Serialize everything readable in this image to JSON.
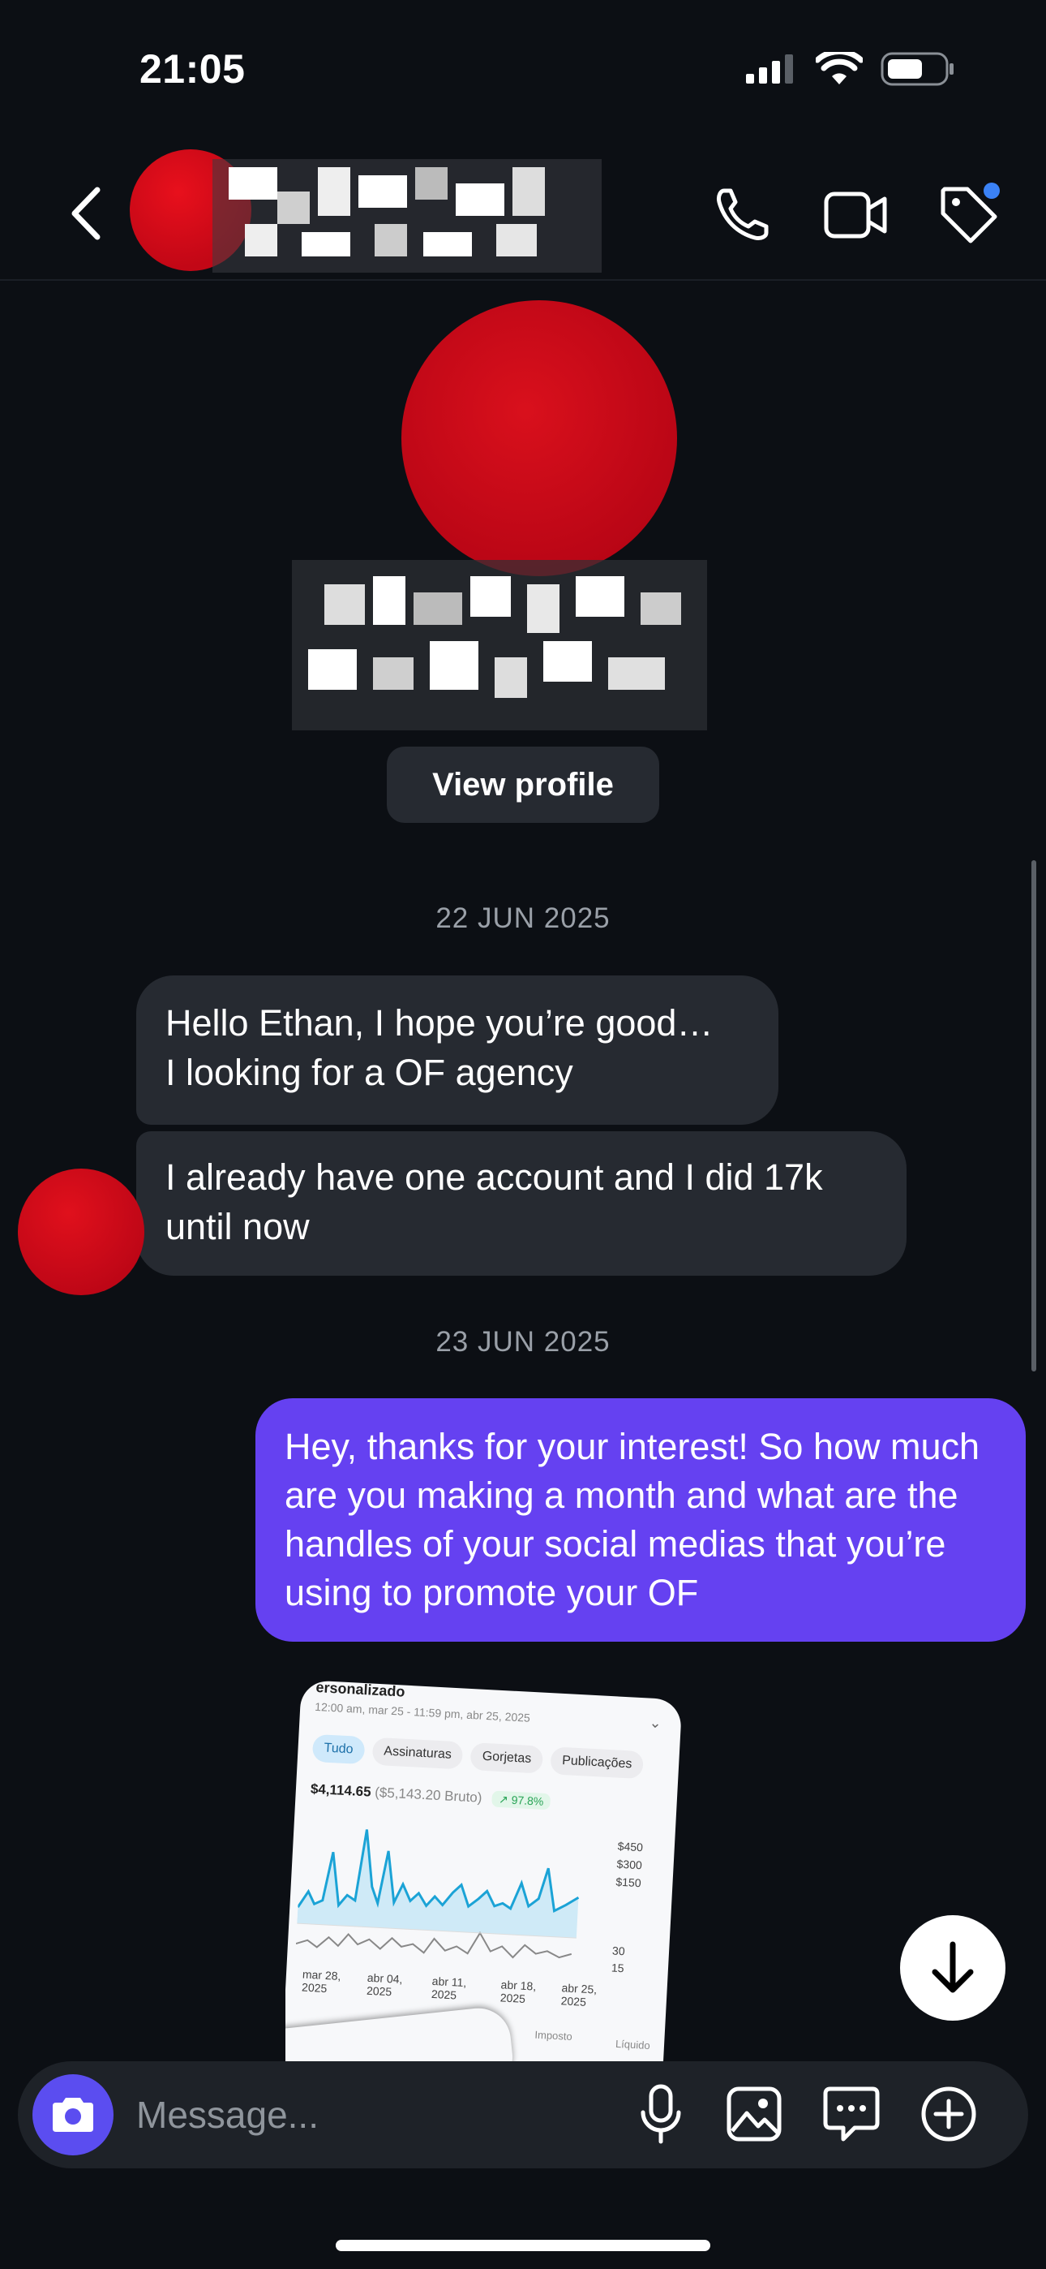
{
  "status_bar": {
    "time": "21:05"
  },
  "conversation": {
    "date_1": "22 JUN 2025",
    "date_2": "23 JUN 2025",
    "incoming": [
      {
        "line1": "Hello Ethan, I hope you’re good…",
        "line2": "I looking for a OF agency"
      },
      {
        "text": "I already have one account and I did 17k until now"
      }
    ],
    "outgoing": [
      {
        "text": "Hey, thanks for your interest! So how much are you making a month and what are the handles of your social medias that you’re using to promote your OF"
      }
    ]
  },
  "profile": {
    "view_profile_label": "View profile"
  },
  "shared_image": {
    "title": "ersonalizado",
    "subtitle": "12:00 am, mar 25 - 11:59 pm, abr 25, 2025",
    "tabs": [
      "Tudo",
      "Assinaturas",
      "Gorjetas",
      "Publicações"
    ],
    "net_amount": "$4,114.65",
    "gross_amount": "($5,143.20 Bruto)",
    "change": "↗ 97.8%",
    "y_labels": [
      "$450",
      "$300",
      "$150",
      "30",
      "15"
    ],
    "x_labels": [
      "mar 28, 2025",
      "abr 04, 2025",
      "abr 11, 2025",
      "abr 18, 2025",
      "abr 25, 2025"
    ],
    "bottom_labels": [
      "Imposto",
      "Líquido"
    ]
  },
  "composer": {
    "placeholder": "Message..."
  },
  "colors": {
    "background": "#0c0f14",
    "incoming_bubble": "#262a31",
    "outgoing_bubble": "#6541f1",
    "camera_button": "#5b4df0",
    "notification_dot": "#3b82f6"
  },
  "icons": {
    "header": [
      "back-arrow-icon",
      "phone-icon",
      "video-camera-icon",
      "tag-icon"
    ],
    "composer": [
      "camera-icon",
      "microphone-icon",
      "gallery-icon",
      "sticker-chat-icon",
      "add-circle-icon"
    ],
    "misc": [
      "arrow-down-icon"
    ]
  }
}
